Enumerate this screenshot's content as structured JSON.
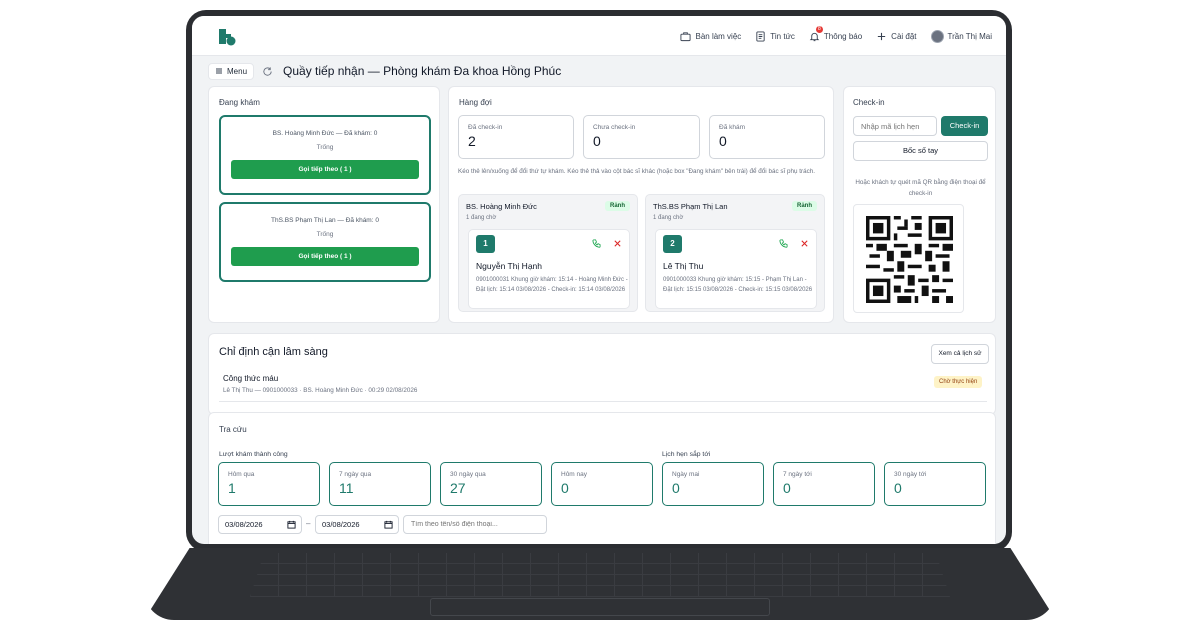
{
  "topbar": {
    "nav": [
      {
        "label": "Bàn làm việc",
        "icon": "briefcase-icon"
      },
      {
        "label": "Tin tức",
        "icon": "news-icon"
      },
      {
        "label": "Thông báo",
        "icon": "bell-icon",
        "badge": "8"
      },
      {
        "label": "Cài đặt",
        "icon": "plus-icon"
      }
    ],
    "user": "Trần Thị Mai"
  },
  "subbar": {
    "menu_label": "Menu",
    "title": "Quầy tiếp nhận — Phòng khám Đa khoa Hồng Phúc"
  },
  "examining": {
    "title": "Đang khám",
    "doctors": [
      {
        "name": "BS. Hoàng Minh Đức — Đã khám: 0",
        "status": "Trống",
        "button": "Gọi tiếp theo ( 1 )"
      },
      {
        "name": "ThS.BS Phạm Thị Lan — Đã khám: 0",
        "status": "Trống",
        "button": "Gọi tiếp theo ( 1 )"
      }
    ]
  },
  "queue": {
    "title": "Hàng đợi",
    "stats": [
      {
        "label": "Đã check-in",
        "value": "2"
      },
      {
        "label": "Chưa check-in",
        "value": "0"
      },
      {
        "label": "Đã khám",
        "value": "0"
      }
    ],
    "hint": "Kéo thẻ lên/xuống để đổi thứ tự khám. Kéo thẻ thả vào cột bác sĩ khác (hoặc box \"Đang khám\" bên trái) để đổi bác sĩ phụ trách.",
    "columns": [
      {
        "doctor": "BS. Hoàng Minh Đức",
        "waiting": "1 đang chờ",
        "tag": "Rảnh",
        "patient": {
          "number": "1",
          "name": "Nguyễn Thị Hạnh",
          "info": "0901000031 Khung giờ khám: 15:14 - Hoàng Minh Đức - Đặt lịch: 15:14 03/08/2026 - Check-in: 15:14 03/08/2026"
        }
      },
      {
        "doctor": "ThS.BS Phạm Thị Lan",
        "waiting": "1 đang chờ",
        "tag": "Rảnh",
        "patient": {
          "number": "2",
          "name": "Lê Thị Thu",
          "info": "0901000033 Khung giờ khám: 15:15 - Phạm Thị Lan - Đặt lịch: 15:15 03/08/2026 - Check-in: 15:15 03/08/2026"
        }
      }
    ]
  },
  "checkin": {
    "title": "Check-in",
    "placeholder": "Nhập mã lịch hẹn",
    "button": "Check-in",
    "manual_button": "Bốc số tay",
    "qr_hint": "Hoặc khách tự quét mã QR bằng điện thoại để check-in"
  },
  "clinical": {
    "title": "Chỉ định cận lâm sàng",
    "history_button": "Xem cả lịch sử",
    "item_name": "Công thức máu",
    "item_detail": "Lê Thị Thu — 0901000033 · BS. Hoàng Minh Đức · 00:29 02/08/2026",
    "item_status": "Chờ thực hiện"
  },
  "lookup": {
    "title": "Tra cứu",
    "success_label": "Lượt khám thành công",
    "upcoming_label": "Lịch hẹn sắp tới",
    "success": [
      {
        "label": "Hôm qua",
        "value": "1"
      },
      {
        "label": "7 ngày qua",
        "value": "11"
      },
      {
        "label": "30 ngày qua",
        "value": "27"
      },
      {
        "label": "Hôm nay",
        "value": "0"
      }
    ],
    "upcoming": [
      {
        "label": "Ngày mai",
        "value": "0"
      },
      {
        "label": "7 ngày tới",
        "value": "0"
      },
      {
        "label": "30 ngày tới",
        "value": "0"
      }
    ],
    "date_from": "03/08/2026",
    "date_sep": "–",
    "date_to": "03/08/2026",
    "search_placeholder": "Tìm theo tên/số điện thoại..."
  },
  "colors": {
    "brand": "#1f7a6b",
    "call_button": "#1f9d4e",
    "stat_value": "#1f7a6b"
  }
}
